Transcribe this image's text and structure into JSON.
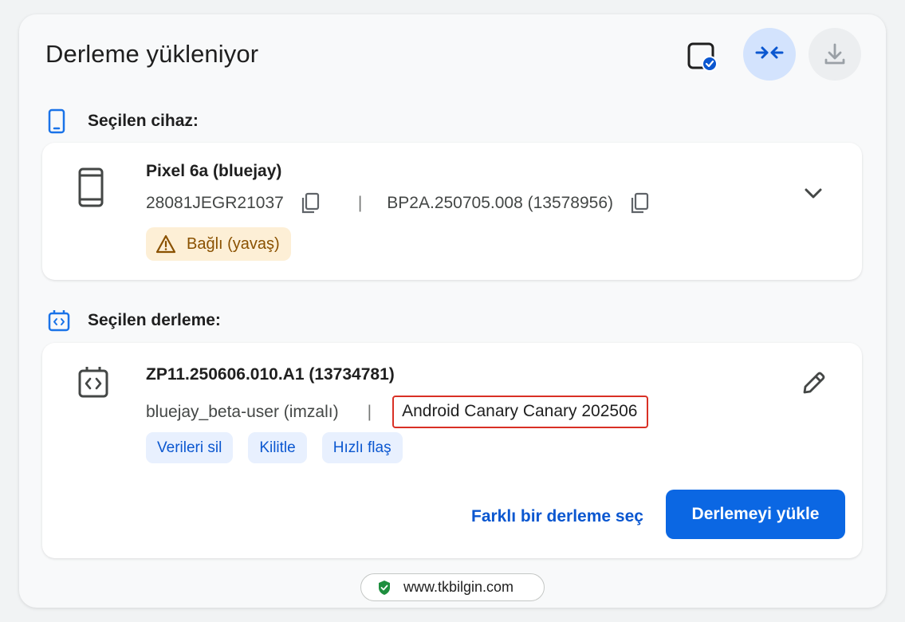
{
  "header": {
    "title": "Derleme yükleniyor",
    "icons": [
      "screen-check-icon",
      "collapse-arrows-icon",
      "download-icon"
    ]
  },
  "device_section": {
    "label": "Seçilen cihaz:",
    "device_name": "Pixel 6a (bluejay)",
    "serial": "28081JEGR21037",
    "separator": "|",
    "build_id": "BP2A.250705.008 (13578956)",
    "status": "Bağlı (yavaş)"
  },
  "build_section": {
    "label": "Seçilen derleme:",
    "build_name": "ZP11.250606.010.A1 (13734781)",
    "target": "bluejay_beta-user (imzalı)",
    "separator": "|",
    "channel": "Android Canary Canary 202506",
    "options": [
      "Verileri sil",
      "Kilitle",
      "Hızlı flaş"
    ],
    "choose_other": "Farklı bir derleme seç",
    "install": "Derlemeyi yükle"
  },
  "footer": {
    "url": "www.tkbilgin.com"
  },
  "colors": {
    "accent": "#0b57d0",
    "primary_button": "#0b67e3",
    "warning_bg": "#fdefd6",
    "warning_text": "#8a5100",
    "highlight_border": "#d93025"
  }
}
